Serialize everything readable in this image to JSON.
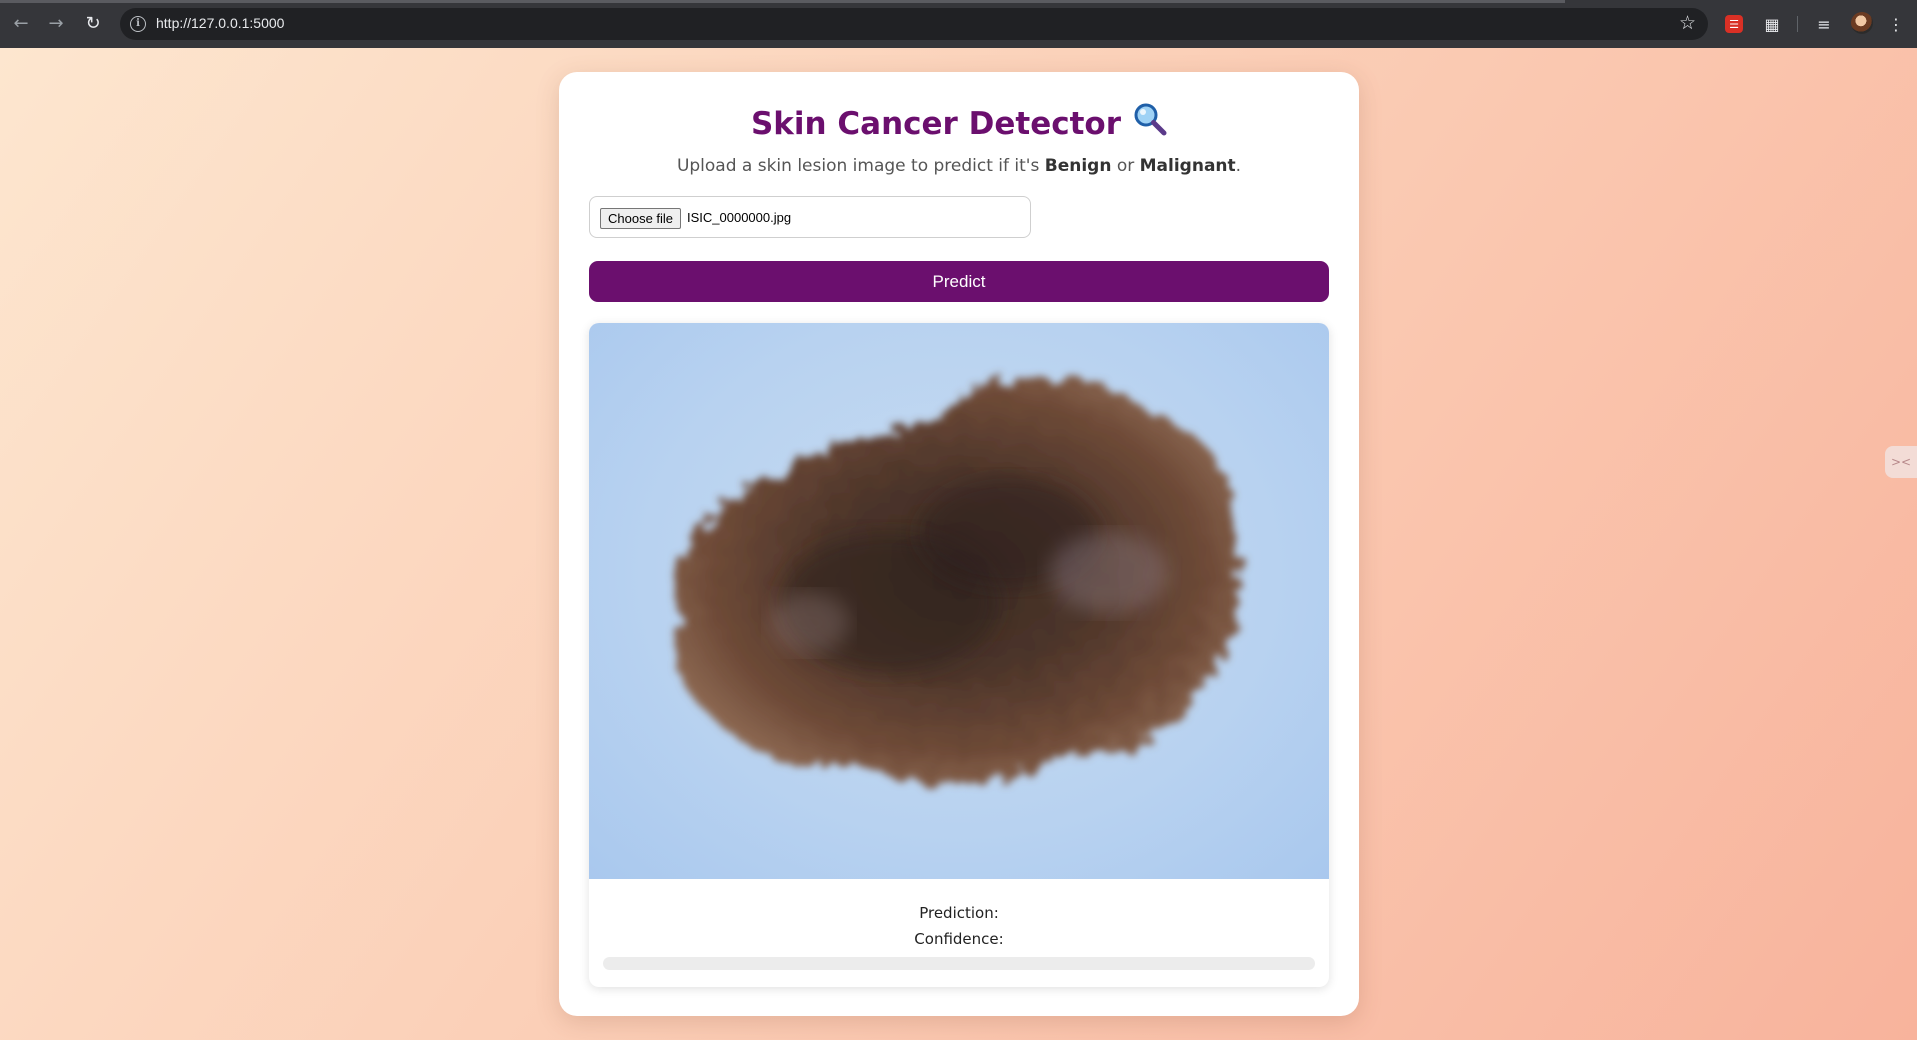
{
  "browser": {
    "url": "http://127.0.0.1:5000"
  },
  "app": {
    "title": "Skin Cancer Detector",
    "title_icon": "magnifying-glass-icon",
    "subtitle_prefix": "Upload a skin lesion image to predict if it's ",
    "subtitle_benign": "Benign",
    "subtitle_or": " or ",
    "subtitle_malignant": "Malignant",
    "subtitle_suffix": ".",
    "choose_file_label": "Choose file",
    "file_name": "ISIC_0000000.jpg",
    "predict_label": "Predict",
    "prediction_label": "Prediction:",
    "prediction_value": "",
    "confidence_label": "Confidence:",
    "confidence_value": "",
    "confidence_fraction": 0
  },
  "colors": {
    "accent": "#6b0f6e"
  }
}
